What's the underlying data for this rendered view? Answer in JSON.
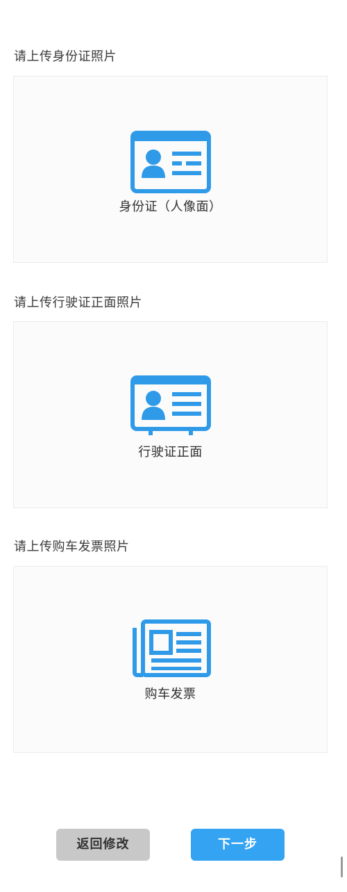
{
  "colors": {
    "accent": "#33a3f2",
    "icon": "#2f9ae8",
    "secondary_button": "#c8c8c8"
  },
  "sections": [
    {
      "label": "请上传身份证照片",
      "icon": "id-card-icon",
      "caption": "身份证（人像面）"
    },
    {
      "label": "请上传行驶证正面照片",
      "icon": "license-card-icon",
      "caption": "行驶证正面"
    },
    {
      "label": "请上传购车发票照片",
      "icon": "newspaper-icon",
      "caption": "购车发票"
    }
  ],
  "buttons": {
    "back_label": "返回修改",
    "next_label": "下一步"
  }
}
